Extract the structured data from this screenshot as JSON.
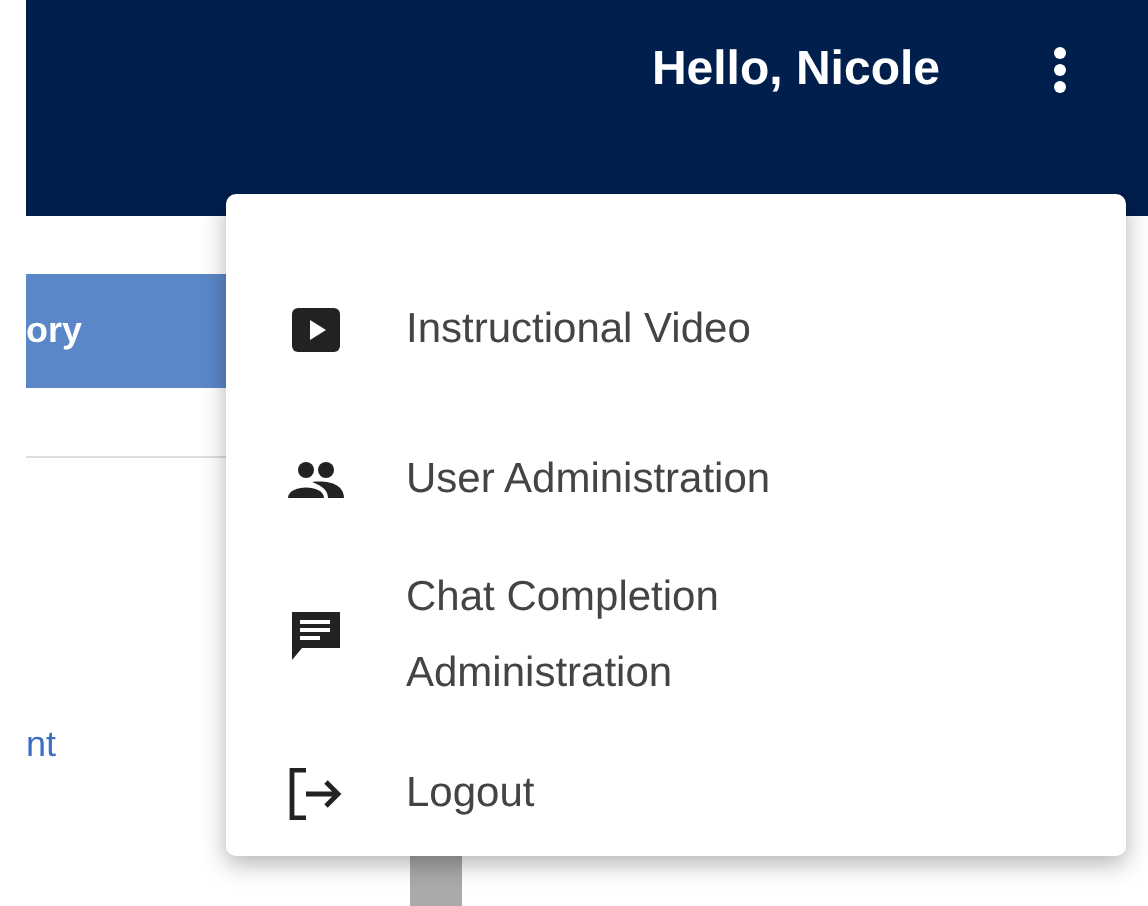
{
  "header": {
    "greeting": "Hello, Nicole"
  },
  "background": {
    "tab": {
      "label": "ory",
      "selected": true
    },
    "link": "nt"
  },
  "menu": {
    "items": [
      {
        "kind": "video",
        "label": "Instructional Video"
      },
      {
        "kind": "users",
        "label": "User Administration"
      },
      {
        "kind": "chat",
        "label": "Chat Completion Administration"
      },
      {
        "kind": "logout",
        "label": "Logout"
      }
    ]
  }
}
